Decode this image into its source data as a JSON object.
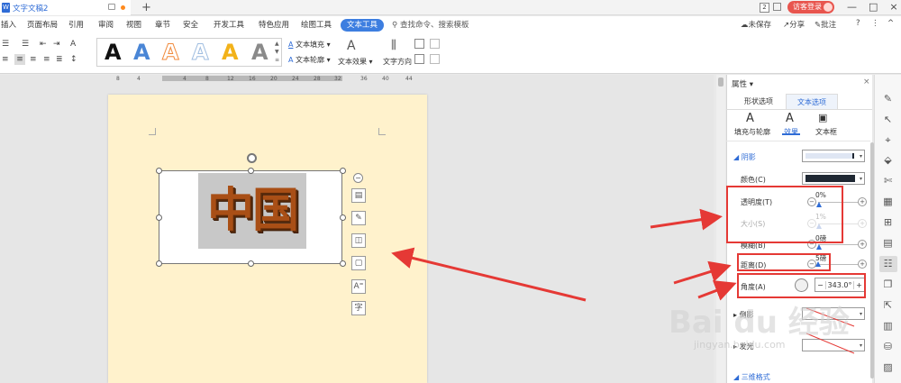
{
  "titlebar": {
    "doc_name": "文字文稿2",
    "new_tab": "+",
    "page_count": "2",
    "guest_label": "访客登录",
    "window_buttons": [
      "—",
      "□",
      "×"
    ]
  },
  "menu": {
    "items": [
      "插入",
      "页面布局",
      "引用",
      "审阅",
      "视图",
      "章节",
      "安全",
      "开发工具",
      "特色应用",
      "绘图工具"
    ],
    "active": "文本工具",
    "search": "查找命令、搜索模板",
    "right": {
      "unsaved": "未保存",
      "share": "分享",
      "annotate": "批注",
      "help": "?",
      "more": "⋮",
      "collapse": "^"
    }
  },
  "ribbon": {
    "style_letters": [
      "A",
      "A",
      "A",
      "A",
      "A",
      "A"
    ],
    "style_colors": [
      "#111111",
      "#4a86d6",
      "#f08a3c",
      "#9fbde0",
      "#f2b21a",
      "#8a8a8a"
    ],
    "text_fill": "文本填充",
    "text_outline": "文本轮廓",
    "text_effect": "文本效果",
    "text_direction": "文字方向"
  },
  "ruler": {
    "ticks": [
      "8",
      "4",
      "4",
      "8",
      "12",
      "16",
      "20",
      "24",
      "28",
      "32",
      "36",
      "40",
      "44"
    ]
  },
  "document": {
    "textbox_text": "中国"
  },
  "float_tools": [
    "−",
    "▤",
    "✎",
    "◫",
    "▢",
    "A⁼",
    "字"
  ],
  "panel": {
    "title": "属性",
    "tabs": [
      "形状选项",
      "文本选项"
    ],
    "active_tab": "文本选项",
    "subtabs": [
      "填充与轮廓",
      "效果",
      "文本框"
    ],
    "active_subtab": "效果",
    "shadow": {
      "section": "阴影",
      "color_label": "颜色(C)",
      "color_value": "#1f2833",
      "transparency_label": "透明度(T)",
      "transparency_value": "0%",
      "size_label": "大小(S)",
      "size_value": "1%",
      "blur_label": "模糊(B)",
      "blur_value": "0磅",
      "distance_label": "距离(D)",
      "distance_value": "5磅",
      "angle_label": "角度(A)",
      "angle_value": "343.0°"
    },
    "reflection_label": "倒影",
    "glow_label": "发光",
    "threed_label": "三维格式"
  },
  "watermark": {
    "main": "Bai du 经验",
    "sub": "jingyan.baidu.com"
  },
  "colors": {
    "accent": "#2f6cd6",
    "annotation": "#e53935",
    "page": "#fff2cc",
    "text_3d": "#a94f16"
  }
}
